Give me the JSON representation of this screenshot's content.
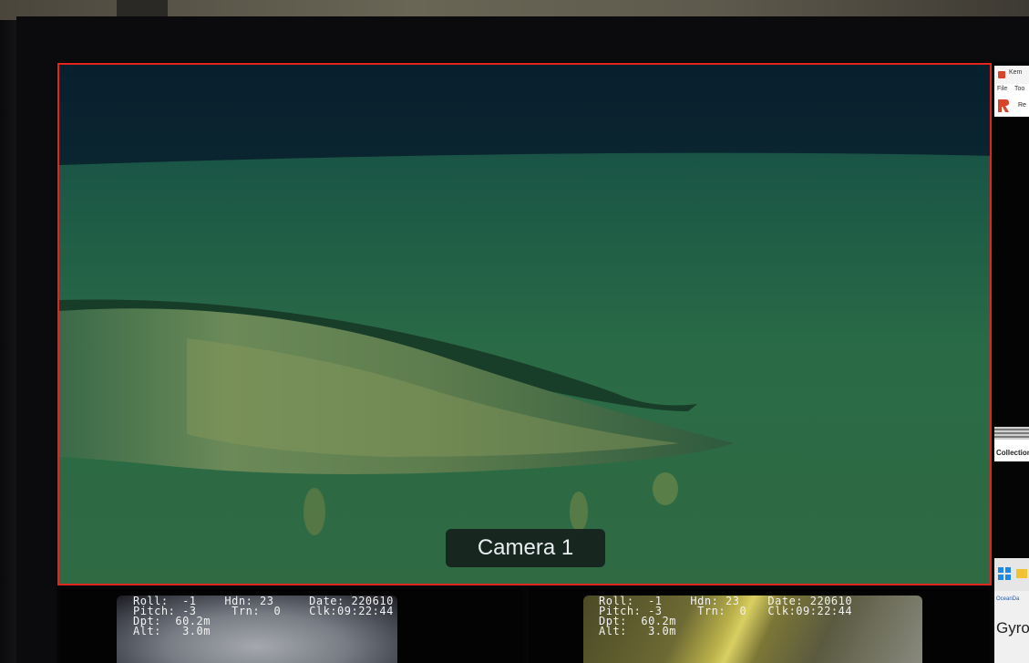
{
  "main_feed": {
    "camera_label": "Camera 1",
    "border_color": "#e0261e"
  },
  "sub_feeds": [
    {
      "telemetry": {
        "line1": "Roll:  -1    Hdn: 23     Date: 220610",
        "line2": "Pitch: -3     Trn:  0    Clk:09:22:44",
        "line3": "Dpt:  60.2m",
        "line4": "Alt:   3.0m"
      }
    },
    {
      "telemetry": {
        "line1": "Roll:  -1    Hdn: 23    Date: 220610",
        "line2": "Pitch: -3     Trn:  0   Clk:09:22:44",
        "line3": "Dpt:  60.2m",
        "line4": "Alt:   3.0m"
      }
    }
  ],
  "side_app": {
    "title": "Kem",
    "menu_file": "File",
    "menu_tools": "Too",
    "header_text": "Re",
    "collection_label": "Collection",
    "bottom_tab": "OceanDa",
    "gyro_label": "Gyro"
  }
}
